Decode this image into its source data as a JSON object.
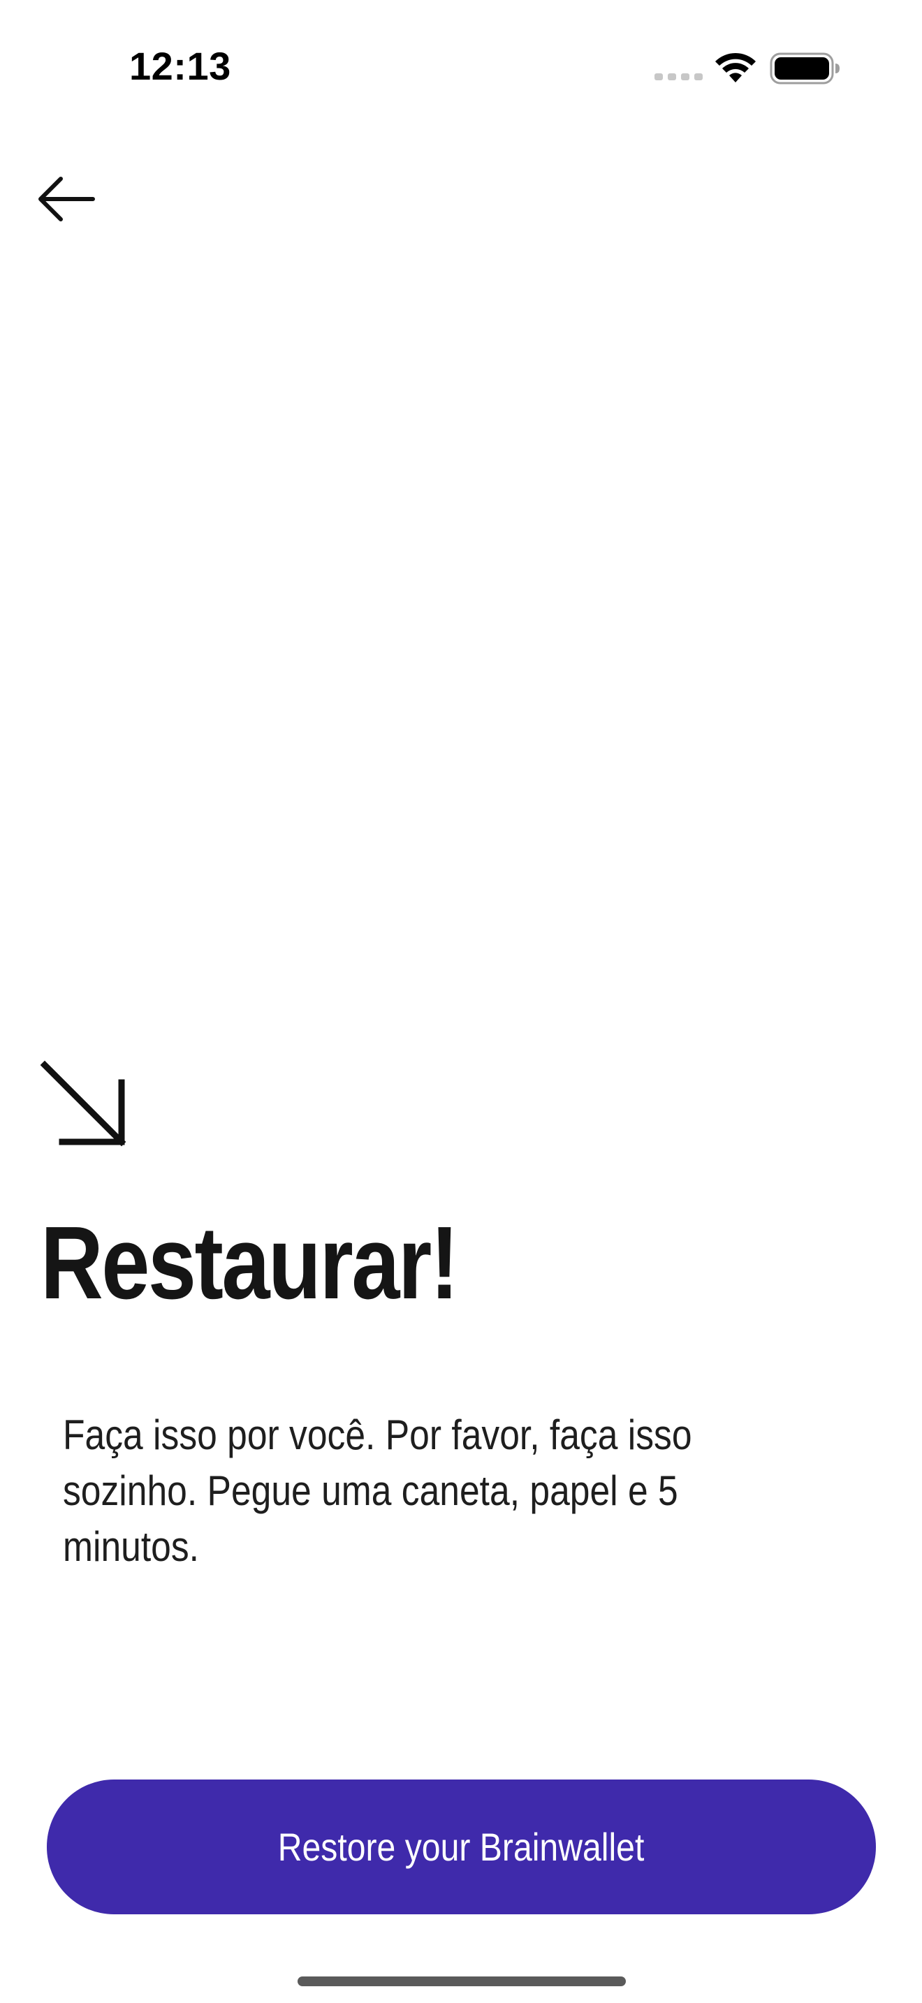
{
  "status_bar": {
    "time": "12:13",
    "icons": [
      "signal-icon",
      "wifi-icon",
      "battery-icon"
    ]
  },
  "header": {
    "back_icon": "arrow-left-icon"
  },
  "main": {
    "decor_icon": "arrow-down-right-icon",
    "title": "Restaurar!",
    "description": "Faça isso por você. Por favor, faça isso sozinho. Pegue uma caneta, papel e 5 minutos."
  },
  "footer": {
    "restore_button_label": "Restore your Brainwallet"
  },
  "colors": {
    "primary": "#3f2aab",
    "text": "#151515",
    "background": "#ffffff"
  }
}
